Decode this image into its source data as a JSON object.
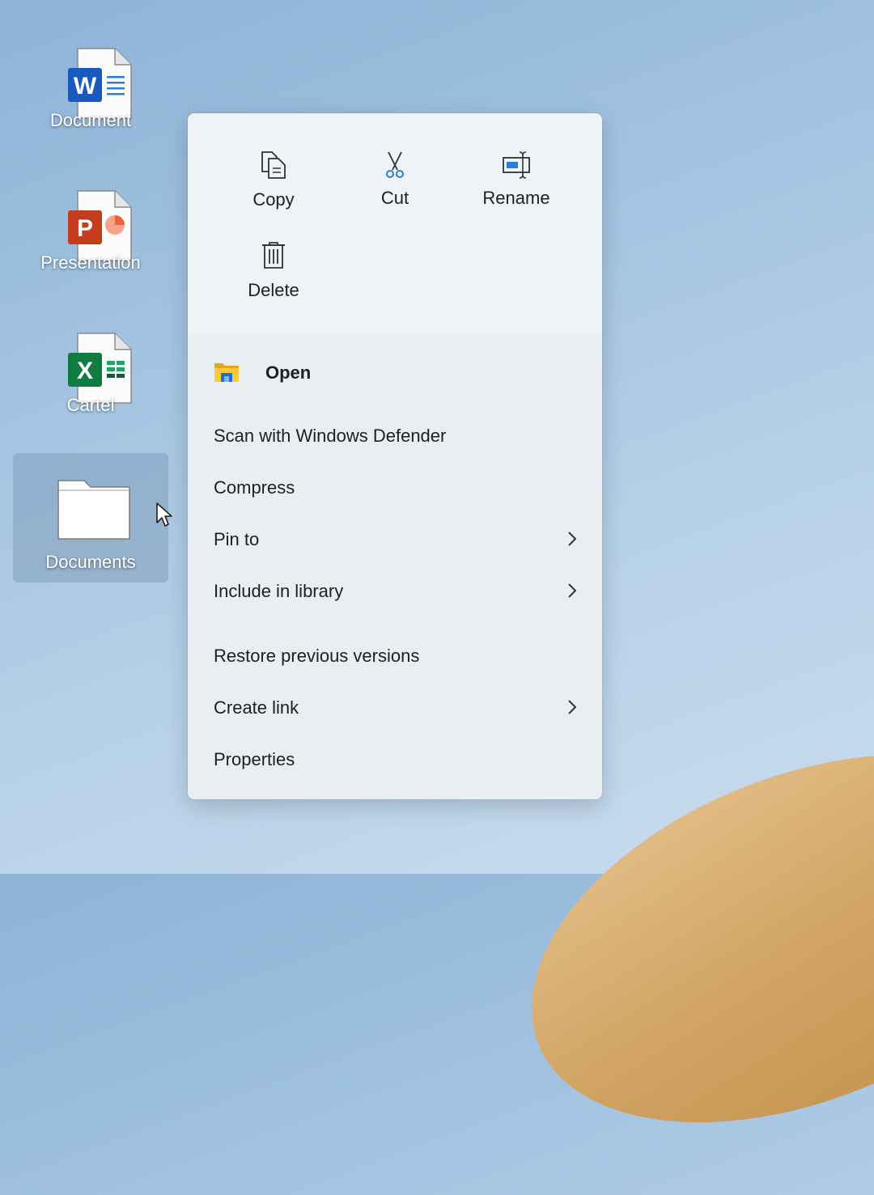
{
  "desktop": {
    "icons": [
      {
        "label": "Document",
        "type": "word"
      },
      {
        "label": "Presentation",
        "type": "powerpoint"
      },
      {
        "label": "Cartel",
        "type": "excel"
      },
      {
        "label": "Documents",
        "type": "folder",
        "selected": true
      }
    ],
    "colors": {
      "word": "#185abd",
      "powerpoint": "#c43e1c",
      "excel": "#107c41"
    }
  },
  "context_menu": {
    "quick_actions": [
      {
        "label": "Copy",
        "icon": "copy-icon"
      },
      {
        "label": "Cut",
        "icon": "scissors-icon"
      },
      {
        "label": "Rename",
        "icon": "rename-icon"
      },
      {
        "label": "Delete",
        "icon": "trash-icon"
      }
    ],
    "items": [
      {
        "label": "Open",
        "icon": "file-explorer-icon",
        "bold": true
      },
      {
        "label": "Scan with Windows Defender"
      },
      {
        "label": "Compress"
      },
      {
        "label": "Pin to",
        "submenu": true
      },
      {
        "label": "Include in library",
        "submenu": true
      },
      {
        "label": "Restore previous versions"
      },
      {
        "label": "Create link",
        "submenu": true
      },
      {
        "label": "Properties"
      }
    ]
  }
}
